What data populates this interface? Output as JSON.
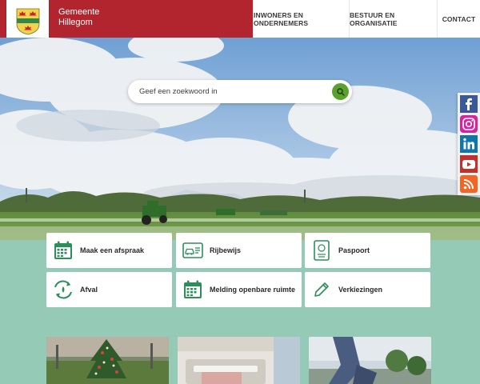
{
  "header": {
    "brand_line1": "Gemeente",
    "brand_line2": "Hillegom",
    "brand_color": "#b3252e",
    "nav": [
      {
        "label": "INWONERS EN ONDERNEMERS"
      },
      {
        "label": "BESTUUR EN ORGANISATIE"
      },
      {
        "label": "CONTACT"
      }
    ]
  },
  "search": {
    "placeholder": "Geef een zoekwoord in",
    "button_icon": "search-icon",
    "button_color": "#5aa12e"
  },
  "social": [
    {
      "icon": "facebook-icon",
      "color": "#3b5998"
    },
    {
      "icon": "instagram-icon",
      "color": "#d6249f"
    },
    {
      "icon": "linkedin-icon",
      "color": "#0e76a8"
    },
    {
      "icon": "youtube-icon",
      "color": "#c4302b"
    },
    {
      "icon": "rss-icon",
      "color": "#f26522"
    }
  ],
  "tiles": [
    {
      "label": "Maak een afspraak",
      "icon": "calendar-icon"
    },
    {
      "label": "Rijbewijs",
      "icon": "drivers-license-icon"
    },
    {
      "label": "Paspoort",
      "icon": "passport-icon"
    },
    {
      "label": "Afval",
      "icon": "recycle-icon"
    },
    {
      "label": "Melding openbare ruimte",
      "icon": "calendar-icon"
    },
    {
      "label": "Verkiezingen",
      "icon": "pencil-icon"
    }
  ],
  "theme": {
    "icon_green": "#2b8f5a",
    "page_background": "#95cbb6"
  }
}
